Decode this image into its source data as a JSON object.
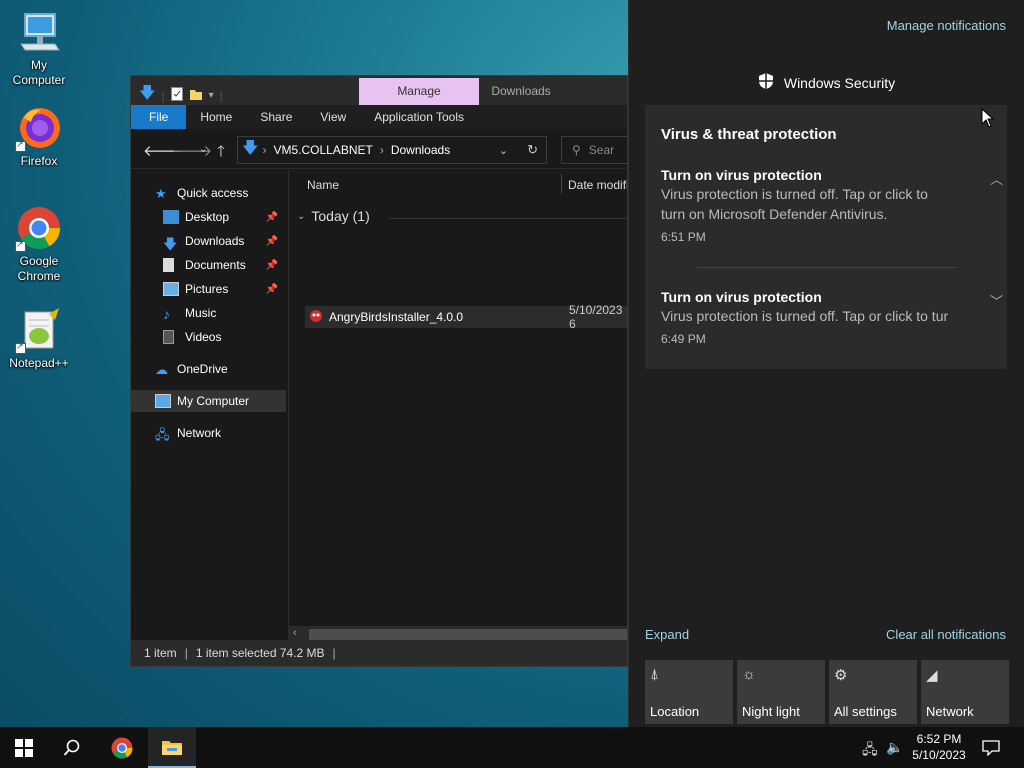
{
  "desktop": {
    "icons": [
      {
        "label": "My Computer",
        "icon": "computer-icon"
      },
      {
        "label": "Firefox",
        "icon": "firefox-icon"
      },
      {
        "label": "Google Chrome",
        "icon": "chrome-icon"
      },
      {
        "label": "Notepad++",
        "icon": "notepadpp-icon"
      }
    ]
  },
  "explorer": {
    "contextual_tabs": {
      "manage": "Manage",
      "downloads": "Downloads"
    },
    "ribbon_tabs": [
      "File",
      "Home",
      "Share",
      "View",
      "Application Tools"
    ],
    "address": {
      "root": "VM5.COLLABNET",
      "current": "Downloads"
    },
    "search_placeholder": "Sear",
    "nav_items": [
      {
        "label": "Quick access",
        "pinned": false
      },
      {
        "label": "Desktop",
        "pinned": true
      },
      {
        "label": "Downloads",
        "pinned": true
      },
      {
        "label": "Documents",
        "pinned": true
      },
      {
        "label": "Pictures",
        "pinned": true
      },
      {
        "label": "Music",
        "pinned": false
      },
      {
        "label": "Videos",
        "pinned": false
      },
      {
        "label": "OneDrive",
        "pinned": false
      },
      {
        "label": "My Computer",
        "pinned": false,
        "selected": true
      },
      {
        "label": "Network",
        "pinned": false
      }
    ],
    "columns": {
      "name": "Name",
      "date": "Date modifi"
    },
    "group_label": "Today (1)",
    "files": [
      {
        "name": "AngryBirdsInstaller_4.0.0",
        "date": "5/10/2023 6"
      }
    ],
    "status": {
      "count": "1 item",
      "selection": "1 item selected 74.2 MB"
    }
  },
  "action_center": {
    "manage_label": "Manage notifications",
    "app_name": "Windows Security",
    "group_title": "Virus & threat protection",
    "notifications": [
      {
        "title": "Turn on virus protection",
        "body_line1": "Virus protection is turned off. Tap or click to",
        "body_line2": "turn on Microsoft Defender Antivirus.",
        "time": "6:51 PM",
        "expanded": true
      },
      {
        "title": "Turn on virus protection",
        "body_line1": "Virus protection is turned off. Tap or click to tur",
        "body_line2": "",
        "time": "6:49 PM",
        "expanded": false
      }
    ],
    "expand_label": "Expand",
    "clear_label": "Clear all notifications",
    "quick_actions": [
      {
        "label": "Location",
        "icon": "location-icon"
      },
      {
        "label": "Night light",
        "icon": "night-light-icon"
      },
      {
        "label": "All settings",
        "icon": "gear-icon"
      },
      {
        "label": "Network",
        "icon": "network-icon"
      }
    ]
  },
  "taskbar": {
    "time": "6:52 PM",
    "date": "5/10/2023"
  }
}
